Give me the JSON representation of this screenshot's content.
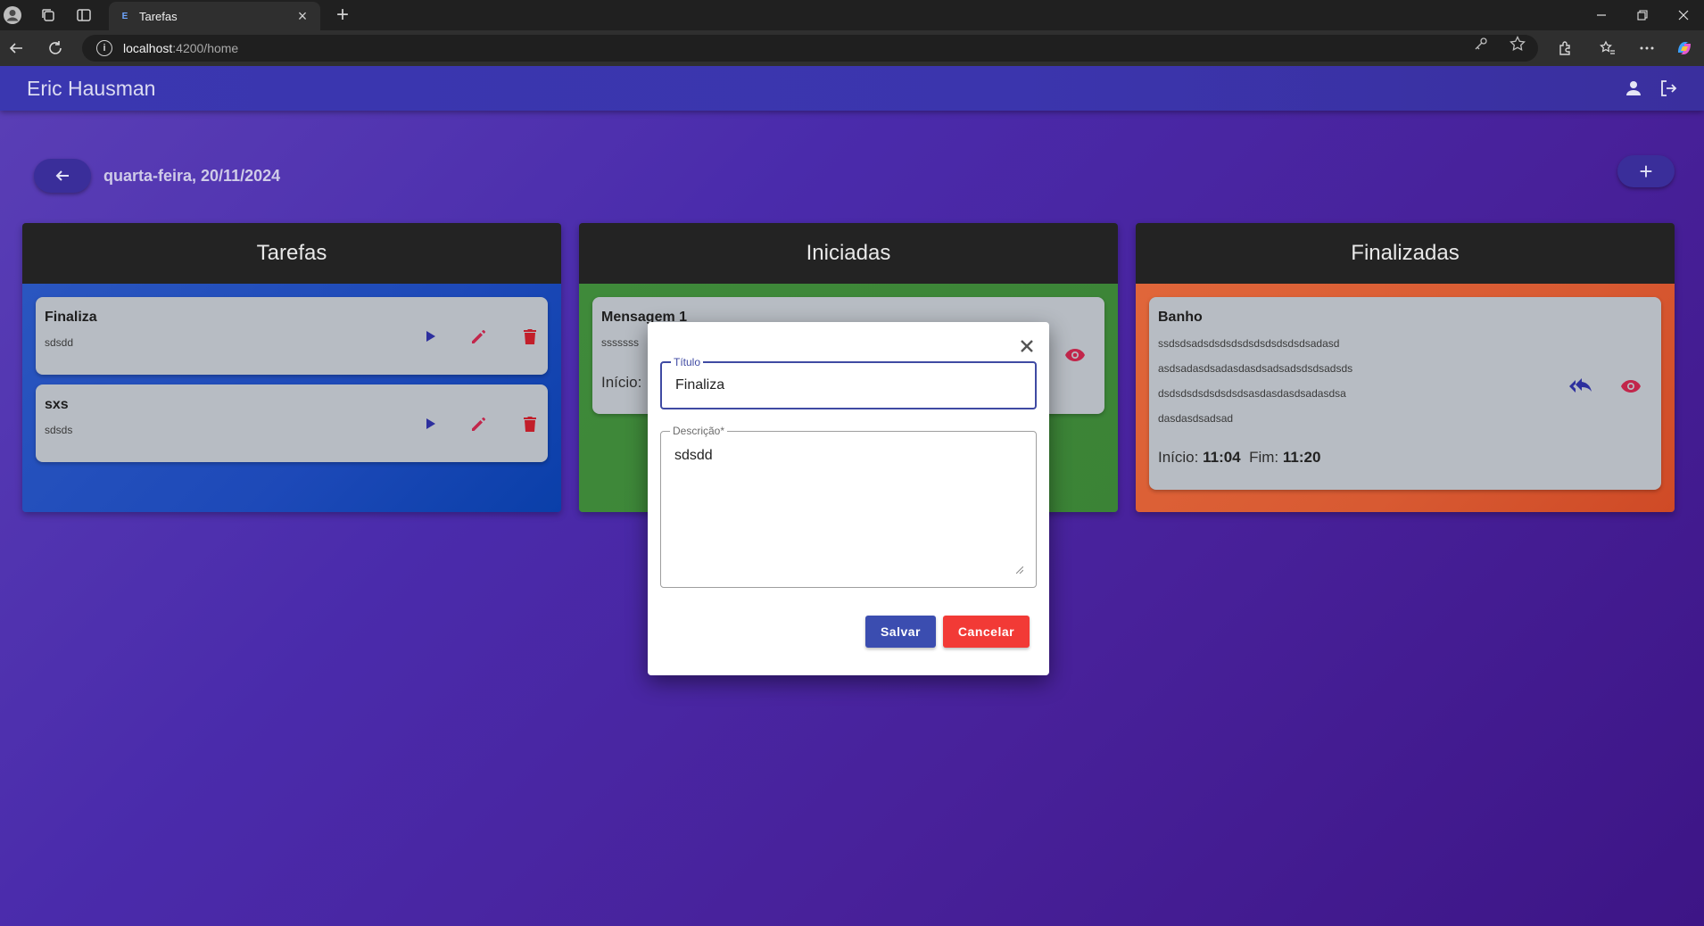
{
  "browser": {
    "tab_title": "Tarefas",
    "tab_favicon": "E",
    "url_host": "localhost",
    "url_path": ":4200/home"
  },
  "app": {
    "user_name": "Eric Hausman",
    "date_label": "quarta-feira, 20/11/2024",
    "add_label": "+"
  },
  "columns": [
    {
      "title": "Tarefas",
      "cards": [
        {
          "title": "Finaliza",
          "description": "sdsdd"
        },
        {
          "title": "sxs",
          "description": "sdsds"
        }
      ]
    },
    {
      "title": "Iniciadas",
      "cards": [
        {
          "title": "Mensagem 1",
          "description": "sssssss",
          "start_label": "Início:"
        }
      ]
    },
    {
      "title": "Finalizadas",
      "cards": [
        {
          "title": "Banho",
          "description_lines": [
            "ssdsdsadsdsdsdsdsdsdsdsdsdsadasd",
            "asdsadasdsadasdasdsadsadsdsdsadsds",
            "dsdsdsdsdsdsdsdsasdasdasdsadasdsa",
            "dasdasdsadsad"
          ],
          "start_label": "Início:",
          "start_time": "11:04",
          "end_label": "Fim:",
          "end_time": "11:20"
        }
      ]
    }
  ],
  "dialog": {
    "title_label": "Título",
    "title_value": "Finaliza",
    "description_label": "Descrição*",
    "description_value": "sdsdd",
    "save_label": "Salvar",
    "cancel_label": "Cancelar"
  },
  "colors": {
    "toolbar": "#3a37b0",
    "column_blue": "#1d49b8",
    "column_green": "#3b8336",
    "column_orange": "#d85a32",
    "save_button": "#3b4db0",
    "cancel_button": "#f23a36",
    "play_icon": "#2d2f9e",
    "edit_icon": "#c2264b",
    "delete_icon": "#c21e2a"
  }
}
